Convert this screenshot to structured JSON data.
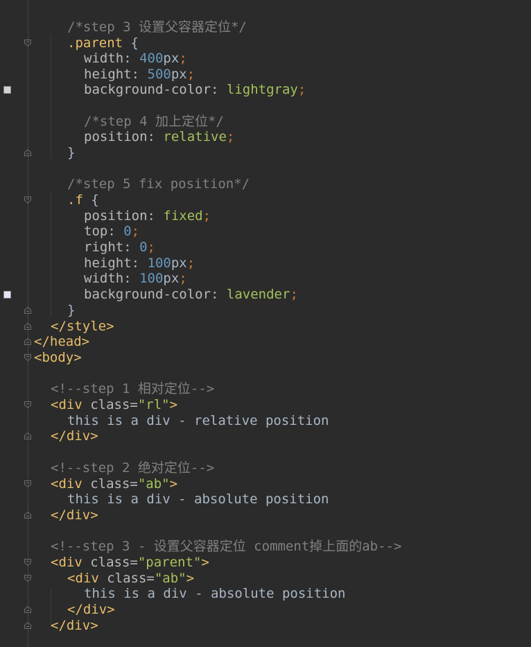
{
  "editor": {
    "colors": {
      "background": "#2b2b2b",
      "comment": "#808080",
      "selector": "#e8bf6a",
      "property": "#bababa",
      "number": "#6897bb",
      "keyword": "#a5c25c",
      "punctuation": "#cc7832",
      "tag": "#e8bf6a",
      "string": "#a5c25c"
    },
    "swatches": {
      "lightgray": "#d3d3d3",
      "lavender": "#e6e6fa"
    },
    "lines": {
      "l1": {
        "tokens": [
          [
            "t-comment",
            "/*step 3 设置父容器定位*/"
          ]
        ]
      },
      "l2": {
        "tokens": [
          [
            "t-selector",
            ".parent"
          ],
          [
            "t-brace",
            " {"
          ]
        ]
      },
      "l3": {
        "tokens": [
          [
            "t-prop",
            "width"
          ],
          [
            "t-plain",
            ": "
          ],
          [
            "t-num",
            "400"
          ],
          [
            "t-unit",
            "px"
          ],
          [
            "t-punct",
            ";"
          ]
        ]
      },
      "l4": {
        "tokens": [
          [
            "t-prop",
            "height"
          ],
          [
            "t-plain",
            ": "
          ],
          [
            "t-num",
            "500"
          ],
          [
            "t-unit",
            "px"
          ],
          [
            "t-punct",
            ";"
          ]
        ]
      },
      "l5": {
        "tokens": [
          [
            "t-prop",
            "background-color"
          ],
          [
            "t-plain",
            ": "
          ],
          [
            "t-kw",
            "lightgray"
          ],
          [
            "t-punct",
            ";"
          ]
        ]
      },
      "l6": {
        "tokens": [
          [
            "t-comment",
            "/*step 4 加上定位*/"
          ]
        ]
      },
      "l7": {
        "tokens": [
          [
            "t-prop",
            "position"
          ],
          [
            "t-plain",
            ": "
          ],
          [
            "t-kw",
            "relative"
          ],
          [
            "t-punct",
            ";"
          ]
        ]
      },
      "l8": {
        "tokens": [
          [
            "t-brace",
            "}"
          ]
        ]
      },
      "l9": {
        "tokens": [
          [
            "t-comment",
            "/*step 5 fix position*/"
          ]
        ]
      },
      "l10": {
        "tokens": [
          [
            "t-selector",
            ".f"
          ],
          [
            "t-brace",
            " {"
          ]
        ]
      },
      "l11": {
        "tokens": [
          [
            "t-prop",
            "position"
          ],
          [
            "t-plain",
            ": "
          ],
          [
            "t-kw",
            "fixed"
          ],
          [
            "t-punct",
            ";"
          ]
        ]
      },
      "l12": {
        "tokens": [
          [
            "t-prop",
            "top"
          ],
          [
            "t-plain",
            ": "
          ],
          [
            "t-num",
            "0"
          ],
          [
            "t-punct",
            ";"
          ]
        ]
      },
      "l13": {
        "tokens": [
          [
            "t-prop",
            "right"
          ],
          [
            "t-plain",
            ": "
          ],
          [
            "t-num",
            "0"
          ],
          [
            "t-punct",
            ";"
          ]
        ]
      },
      "l14": {
        "tokens": [
          [
            "t-prop",
            "height"
          ],
          [
            "t-plain",
            ": "
          ],
          [
            "t-num",
            "100"
          ],
          [
            "t-unit",
            "px"
          ],
          [
            "t-punct",
            ";"
          ]
        ]
      },
      "l15": {
        "tokens": [
          [
            "t-prop",
            "width"
          ],
          [
            "t-plain",
            ": "
          ],
          [
            "t-num",
            "100"
          ],
          [
            "t-unit",
            "px"
          ],
          [
            "t-punct",
            ";"
          ]
        ]
      },
      "l16": {
        "tokens": [
          [
            "t-prop",
            "background-color"
          ],
          [
            "t-plain",
            ": "
          ],
          [
            "t-kw",
            "lavender"
          ],
          [
            "t-punct",
            ";"
          ]
        ]
      },
      "l17": {
        "tokens": [
          [
            "t-brace",
            "}"
          ]
        ]
      },
      "l18": {
        "tokens": [
          [
            "t-tag",
            "</style>"
          ]
        ]
      },
      "l19": {
        "tokens": [
          [
            "t-tag",
            "</head>"
          ]
        ]
      },
      "l20": {
        "tokens": [
          [
            "t-tag",
            "<body>"
          ]
        ]
      },
      "l21": {
        "tokens": [
          [
            "t-comment",
            "<!--step 1 相对定位-->"
          ]
        ]
      },
      "l22": {
        "tokens": [
          [
            "t-tag",
            "<div "
          ],
          [
            "t-attr",
            "class="
          ],
          [
            "t-str",
            "\"rl\""
          ],
          [
            "t-tag",
            ">"
          ]
        ]
      },
      "l23": {
        "tokens": [
          [
            "t-plain",
            "this is a div - relative position"
          ]
        ]
      },
      "l24": {
        "tokens": [
          [
            "t-tag",
            "</div>"
          ]
        ]
      },
      "l25": {
        "tokens": [
          [
            "t-comment",
            "<!--step 2 绝对定位-->"
          ]
        ]
      },
      "l26": {
        "tokens": [
          [
            "t-tag",
            "<div "
          ],
          [
            "t-attr",
            "class="
          ],
          [
            "t-str",
            "\"ab\""
          ],
          [
            "t-tag",
            ">"
          ]
        ]
      },
      "l27": {
        "tokens": [
          [
            "t-plain",
            "this is a div - absolute position"
          ]
        ]
      },
      "l28": {
        "tokens": [
          [
            "t-tag",
            "</div>"
          ]
        ]
      },
      "l29": {
        "tokens": [
          [
            "t-comment",
            "<!--step 3 - 设置父容器定位 comment掉上面的ab-->"
          ]
        ]
      },
      "l30": {
        "tokens": [
          [
            "t-tag",
            "<div "
          ],
          [
            "t-attr",
            "class="
          ],
          [
            "t-str",
            "\"parent\""
          ],
          [
            "t-tag",
            ">"
          ]
        ]
      },
      "l31": {
        "tokens": [
          [
            "t-tag",
            "<div "
          ],
          [
            "t-attr",
            "class="
          ],
          [
            "t-str",
            "\"ab\""
          ],
          [
            "t-tag",
            ">"
          ]
        ]
      },
      "l32": {
        "tokens": [
          [
            "t-plain",
            "this is a div - absolute position"
          ]
        ]
      },
      "l33": {
        "tokens": [
          [
            "t-tag",
            "</div>"
          ]
        ]
      },
      "l34": {
        "tokens": [
          [
            "t-tag",
            "</div>"
          ]
        ]
      }
    }
  }
}
